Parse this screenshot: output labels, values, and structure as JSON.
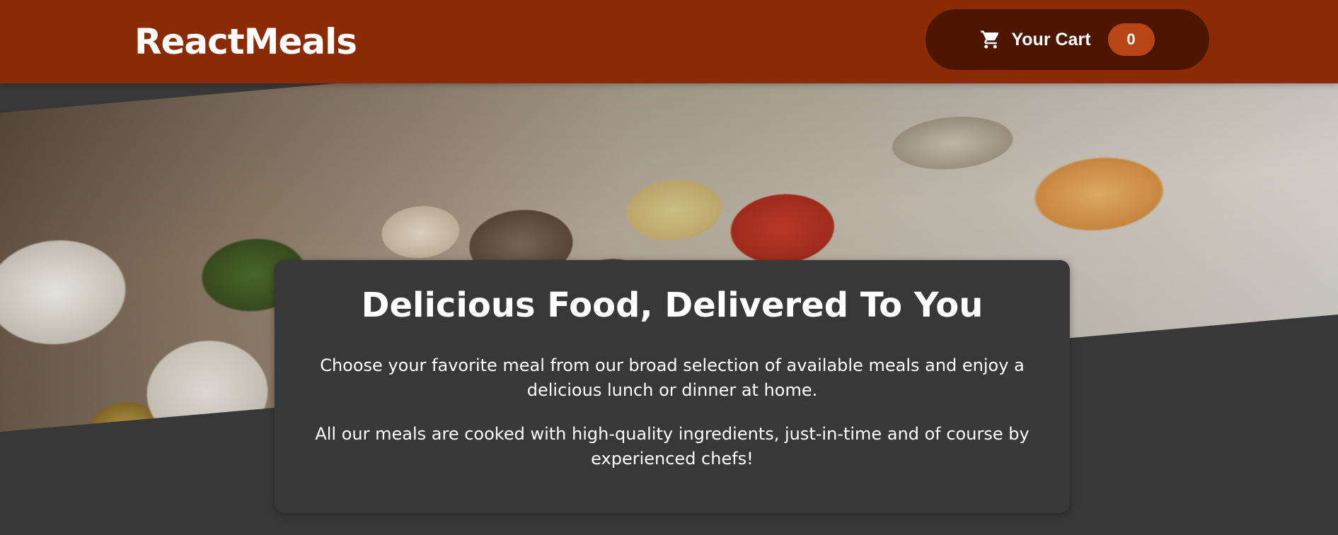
{
  "header": {
    "brand": "ReactMeals",
    "cart": {
      "label": "Your Cart",
      "count": "0",
      "icon": "cart-icon"
    }
  },
  "hero": {
    "image_description_icon": "food-buffet-image"
  },
  "summary": {
    "title": "Delicious Food, Delivered To You",
    "paragraph_1": "Choose your favorite meal from our broad selection of available meals and enjoy a delicious lunch or dinner at home.",
    "paragraph_2": "All our meals are cooked with high-quality ingredients, just-in-time and of course by experienced chefs!"
  },
  "colors": {
    "header_bg": "#8a2b06",
    "cart_button_bg": "#4d1601",
    "cart_badge_bg": "#b94517",
    "page_bg": "#383838"
  }
}
